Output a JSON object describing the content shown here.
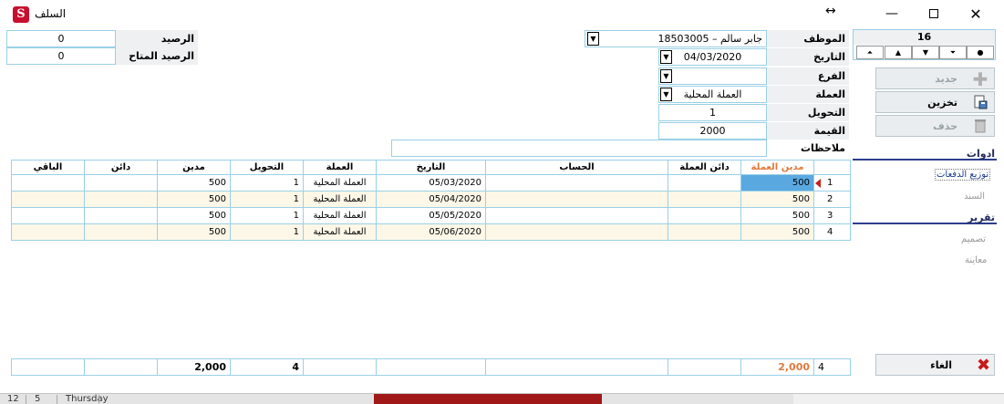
{
  "window": {
    "title": "السلف",
    "logo_letter": "S",
    "move_icon": "↔",
    "minimize": "—",
    "close": "✕"
  },
  "balances": {
    "balance_label": "الرصيد",
    "balance_value": "0",
    "available_label": "الرصيد المتاح",
    "available_value": "0"
  },
  "form": {
    "employee_label": "الموظف",
    "employee_value": "18503005 – جابر سالم",
    "date_label": "التاريخ",
    "date_value": "04/03/2020",
    "branch_label": "الفرع",
    "branch_value": "",
    "currency_label": "العملة",
    "currency_value": "العملة المحلية",
    "conversion_label": "التحويل",
    "conversion_value": "1",
    "amount_label": "القيمة",
    "amount_value": "2000",
    "notes_label": "ملاحظات",
    "notes_value": ""
  },
  "nav": {
    "record_number": "16",
    "first": "⏶",
    "prev": "▲",
    "next": "▼",
    "last": "⏷",
    "new_record": "●"
  },
  "actions": {
    "new_label": "جديد",
    "save_label": "تخزين",
    "delete_label": "حذف",
    "cancel_label": "الغاء"
  },
  "side": {
    "tools_heading": "ادوات",
    "distribute_link": "توزيع الدفعات",
    "voucher_link": "السند",
    "report_heading": "تقرير",
    "design_link": "تصميم",
    "preview_link": "معاينة"
  },
  "grid": {
    "headers": {
      "remaining": "الباقي",
      "credit": "دائن",
      "debit": "مدين",
      "conversion": "التحويل",
      "currency": "العملة",
      "date": "التاريخ",
      "account": "الحساب",
      "credit_currency": "دائن العملة",
      "debit_currency": "مدين العملة",
      "row": ""
    },
    "rows": [
      {
        "n": "1",
        "debit_currency": "500",
        "credit_currency": "",
        "account": "",
        "date": "05/03/2020",
        "currency": "العملة المحلية",
        "conversion": "1",
        "debit": "500",
        "credit": "",
        "remaining": ""
      },
      {
        "n": "2",
        "debit_currency": "500",
        "credit_currency": "",
        "account": "",
        "date": "05/04/2020",
        "currency": "العملة المحلية",
        "conversion": "1",
        "debit": "500",
        "credit": "",
        "remaining": ""
      },
      {
        "n": "3",
        "debit_currency": "500",
        "credit_currency": "",
        "account": "",
        "date": "05/05/2020",
        "currency": "العملة المحلية",
        "conversion": "1",
        "debit": "500",
        "credit": "",
        "remaining": ""
      },
      {
        "n": "4",
        "debit_currency": "500",
        "credit_currency": "",
        "account": "",
        "date": "05/06/2020",
        "currency": "العملة المحلية",
        "conversion": "1",
        "debit": "500",
        "credit": "",
        "remaining": ""
      }
    ],
    "footer": {
      "count": "4",
      "debit_currency_total": "2,000",
      "conversion_total": "4",
      "debit_total": "2,000"
    }
  },
  "taskbar": {
    "a": "12",
    "b": "5",
    "day": "Thursday"
  },
  "colors": {
    "border": "#9ad0e6",
    "highlight_header": "#e07a3c",
    "selected_cell": "#5aa8e0",
    "alt_row": "#fdf7e8",
    "side_heading": "#2d3e8f"
  }
}
